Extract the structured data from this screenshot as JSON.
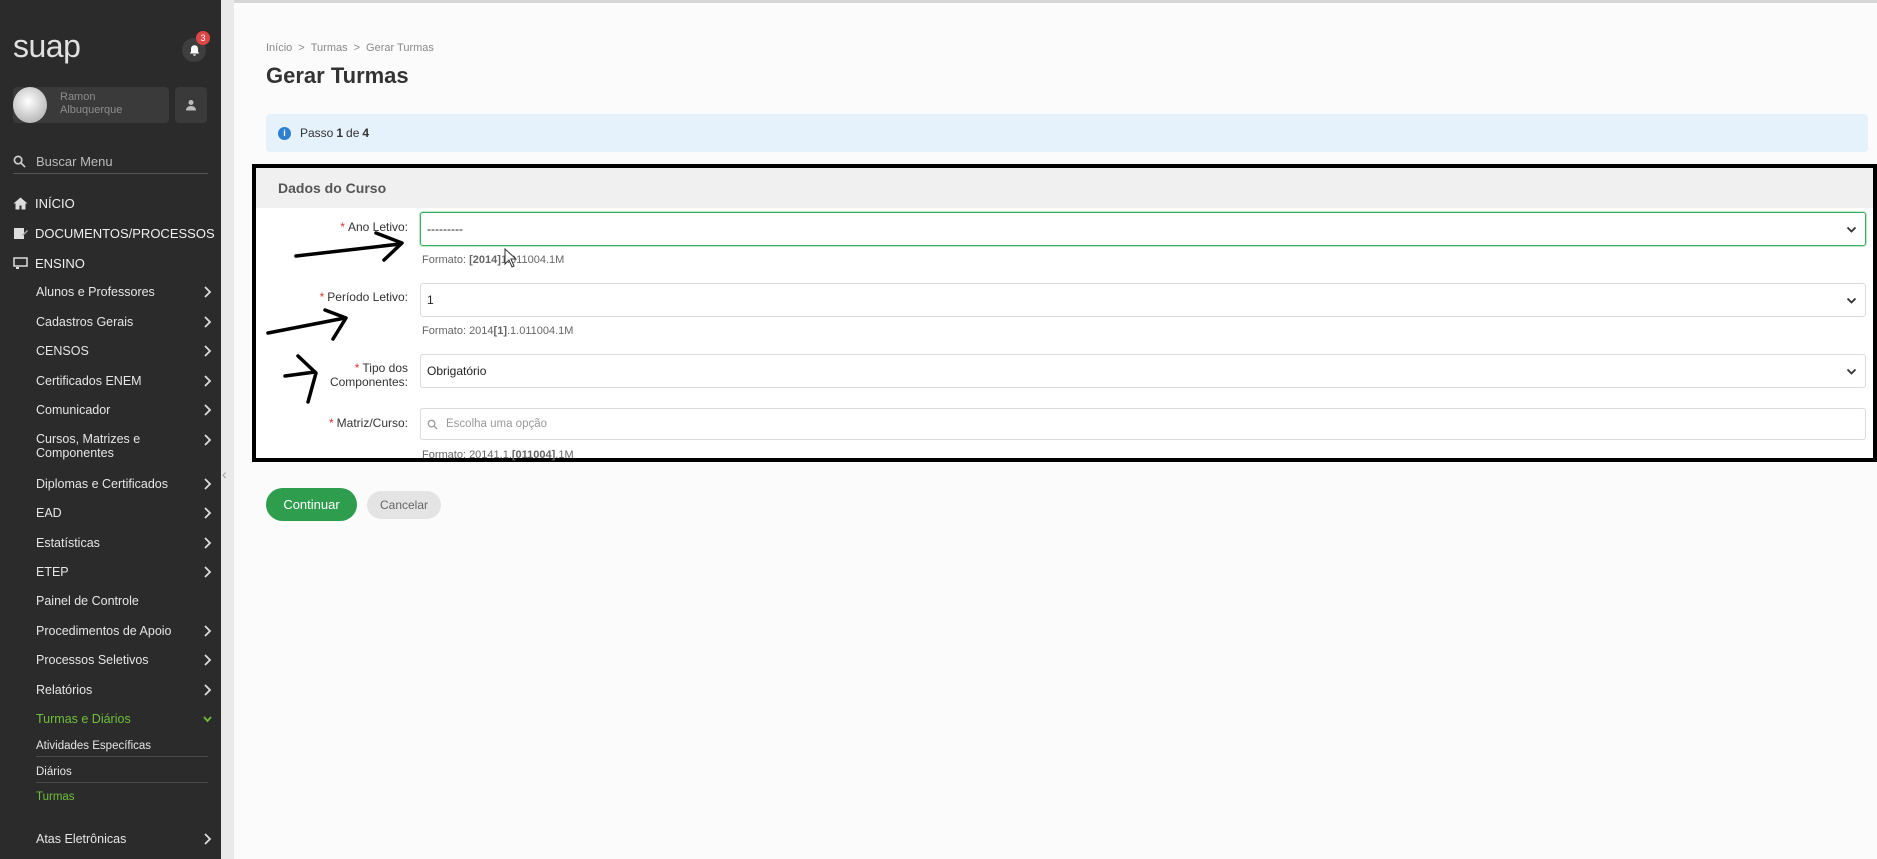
{
  "sidebar": {
    "logo": "suap",
    "notifications_count": "3",
    "user_name": "Ramon Albuquerque",
    "search_placeholder": "Buscar Menu",
    "top_items": [
      {
        "label": "INÍCIO",
        "icon": "home-icon"
      },
      {
        "label": "DOCUMENTOS/PROCESSOS",
        "icon": "document-icon"
      },
      {
        "label": "ENSINO",
        "icon": "teaching-icon"
      }
    ],
    "ensino_items": [
      "Alunos e Professores",
      "Cadastros Gerais",
      "CENSOS",
      "Certificados ENEM",
      "Comunicador",
      "Cursos, Matrizes e Componentes",
      "Diplomas e Certificados",
      "EAD",
      "Estatísticas",
      "ETEP",
      "Painel de Controle",
      "Procedimentos de Apoio",
      "Processos Seletivos",
      "Relatórios",
      "Turmas e Diários"
    ],
    "turmas_sub": [
      "Atividades Específicas",
      "Diários",
      "Turmas"
    ],
    "last_item": "Atas Eletrônicas"
  },
  "breadcrumb": [
    "Início",
    "Turmas",
    "Gerar Turmas"
  ],
  "breadcrumb_sep": ">",
  "page_title": "Gerar Turmas",
  "step": {
    "prefix": "Passo",
    "current": "1",
    "of": "de",
    "total": "4"
  },
  "form": {
    "section_title": "Dados do Curso",
    "required_mark": "*",
    "ano_letivo": {
      "label": "Ano Letivo:",
      "value": "---------",
      "hint_prefix": "Formato:",
      "hint_bold": "[2014]",
      "hint_rest": "1.011004.1M"
    },
    "periodo_letivo": {
      "label": "Período Letivo:",
      "value": "1",
      "hint_prefix": "Formato: 2014",
      "hint_bold": "[1]",
      "hint_rest": ".1.011004.1M"
    },
    "tipo_componentes": {
      "label_1": "Tipo dos",
      "label_2": "Componentes:",
      "value": "Obrigatório"
    },
    "matriz_curso": {
      "label": "Matriz/Curso:",
      "placeholder": "Escolha uma opção",
      "hint_prefix": "Formato: 20141.1.",
      "hint_bold": "[011004]",
      "hint_rest": ".1M"
    }
  },
  "buttons": {
    "continue": "Continuar",
    "cancel": "Cancelar"
  }
}
